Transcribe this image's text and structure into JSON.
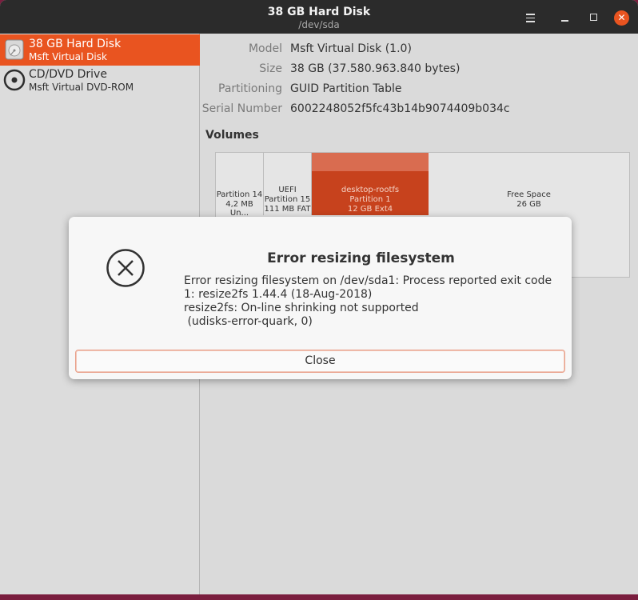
{
  "titlebar": {
    "title": "38 GB Hard Disk",
    "subtitle": "/dev/sda",
    "menu_icon": "hamburger-menu-icon",
    "minimize_icon": "minimize-icon",
    "maximize_icon": "maximize-icon",
    "close_glyph": "✕"
  },
  "sidebar": {
    "items": [
      {
        "name": "38 GB Hard Disk",
        "sub": "Msft Virtual Disk",
        "icon": "hard-disk-icon",
        "selected": true
      },
      {
        "name": "CD/DVD Drive",
        "sub": "Msft Virtual DVD-ROM",
        "icon": "optical-disc-icon",
        "selected": false
      }
    ]
  },
  "details": {
    "model_label": "Model",
    "model_value": "Msft Virtual Disk (1.0)",
    "size_label": "Size",
    "size_value": "38 GB (37.580.963.840 bytes)",
    "partitioning_label": "Partitioning",
    "partitioning_value": "GUID Partition Table",
    "serial_label": "Serial Number",
    "serial_value": "6002248052f5fc43b14b9074409b034c"
  },
  "volumes": {
    "title": "Volumes",
    "partitions": [
      {
        "line1": "Partition 14",
        "line2": "4,2 MB Un..."
      },
      {
        "line1": "UEFI",
        "line2": "Partition 15",
        "line3": "111 MB FAT"
      },
      {
        "line1": "desktop-rootfs",
        "line2": "Partition 1",
        "line3": "12 GB Ext4",
        "selected": true
      },
      {
        "line1": "Free Space",
        "line2": "26 GB"
      }
    ]
  },
  "dialog": {
    "icon": "error-circle-x-icon",
    "title": "Error resizing filesystem",
    "message": "Error resizing filesystem on /dev/sda1: Process reported exit code\n1: resize2fs 1.44.4 (18-Aug-2018)\nresize2fs: On-line shrinking not supported\n (udisks-error-quark, 0)",
    "close_label": "Close"
  },
  "colors": {
    "accent": "#e95420",
    "titlebar": "#2b2b2b",
    "selected_partition": "#c7421d"
  }
}
